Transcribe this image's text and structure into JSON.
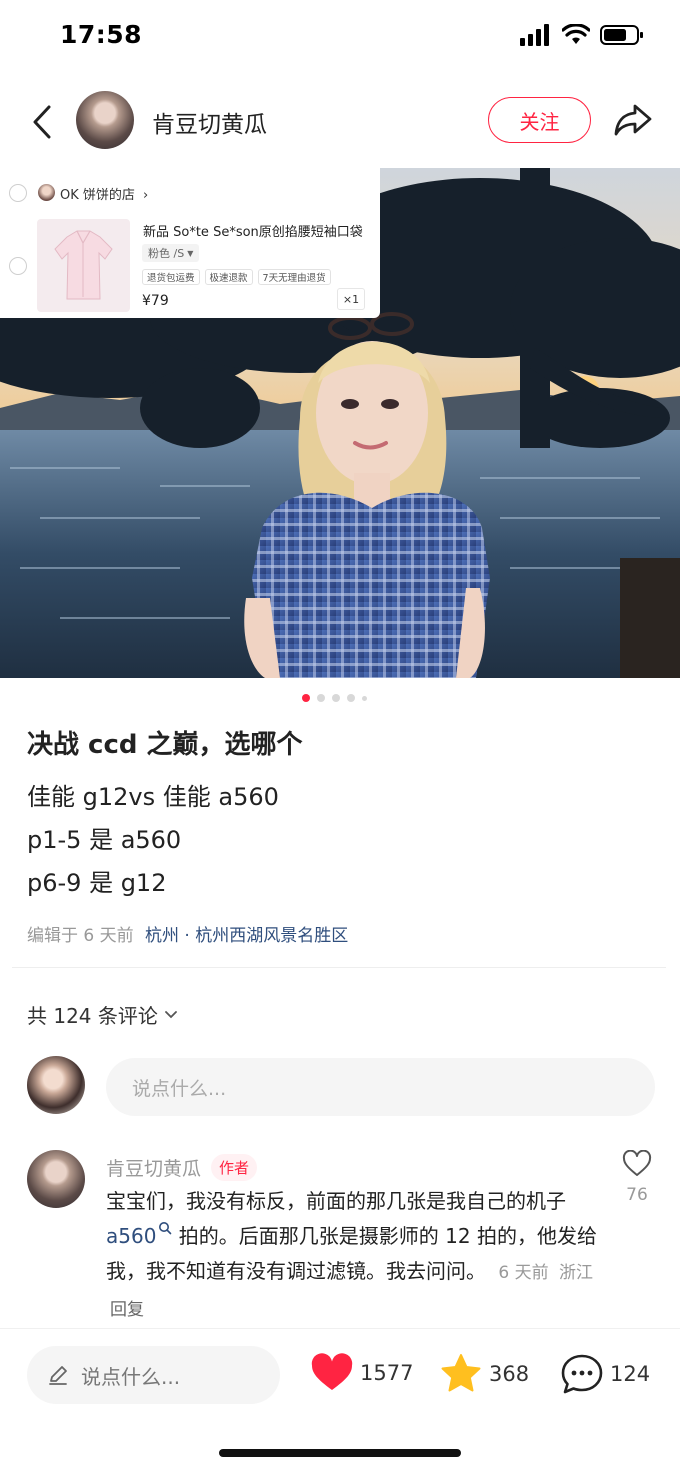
{
  "status_bar": {
    "time": "17:58"
  },
  "header": {
    "author_name": "肯豆切黄瓜",
    "follow_label": "关注"
  },
  "product_card": {
    "shop_name": "OK 饼饼的店",
    "title": "新品 So*te Se*son原创掐腰短袖口袋",
    "variant": "粉色 /S",
    "tags": [
      "退货包运费",
      "极速退款",
      "7天无理由退货"
    ],
    "price": "¥79",
    "quantity": "×1"
  },
  "carousel": {
    "active_index": 1,
    "total": 5
  },
  "post": {
    "title": "决战 ccd 之巅，选哪个",
    "body": [
      "佳能 g12vs 佳能 a560",
      "p1-5 是 a560",
      "p6-9 是 g12"
    ],
    "meta_prefix": "编辑于  6 天前",
    "location": "杭州 · 杭州西湖风景名胜区"
  },
  "comments": {
    "count_label": "共 124 条评论",
    "input_placeholder": "说点什么...",
    "items": [
      {
        "author": "肯豆切黄瓜",
        "badge": "作者",
        "text_1": "宝宝们，我没有标反，前面的那几张是我自己的机子 ",
        "link": "a560",
        "text_2": " 拍的。后面那几张是摄影师的 12 拍的，他发给我，我不知道有没有调过滤镜。我去问问。",
        "time": "6 天前",
        "location": "浙江",
        "reply_label": "回复",
        "likes": "76"
      }
    ]
  },
  "bottom_bar": {
    "input_placeholder": "说点什么...",
    "likes": "1577",
    "stars": "368",
    "comments": "124"
  },
  "colors": {
    "accent": "#ff2442",
    "link": "#2f4e7d",
    "star": "#ffbf1f"
  }
}
